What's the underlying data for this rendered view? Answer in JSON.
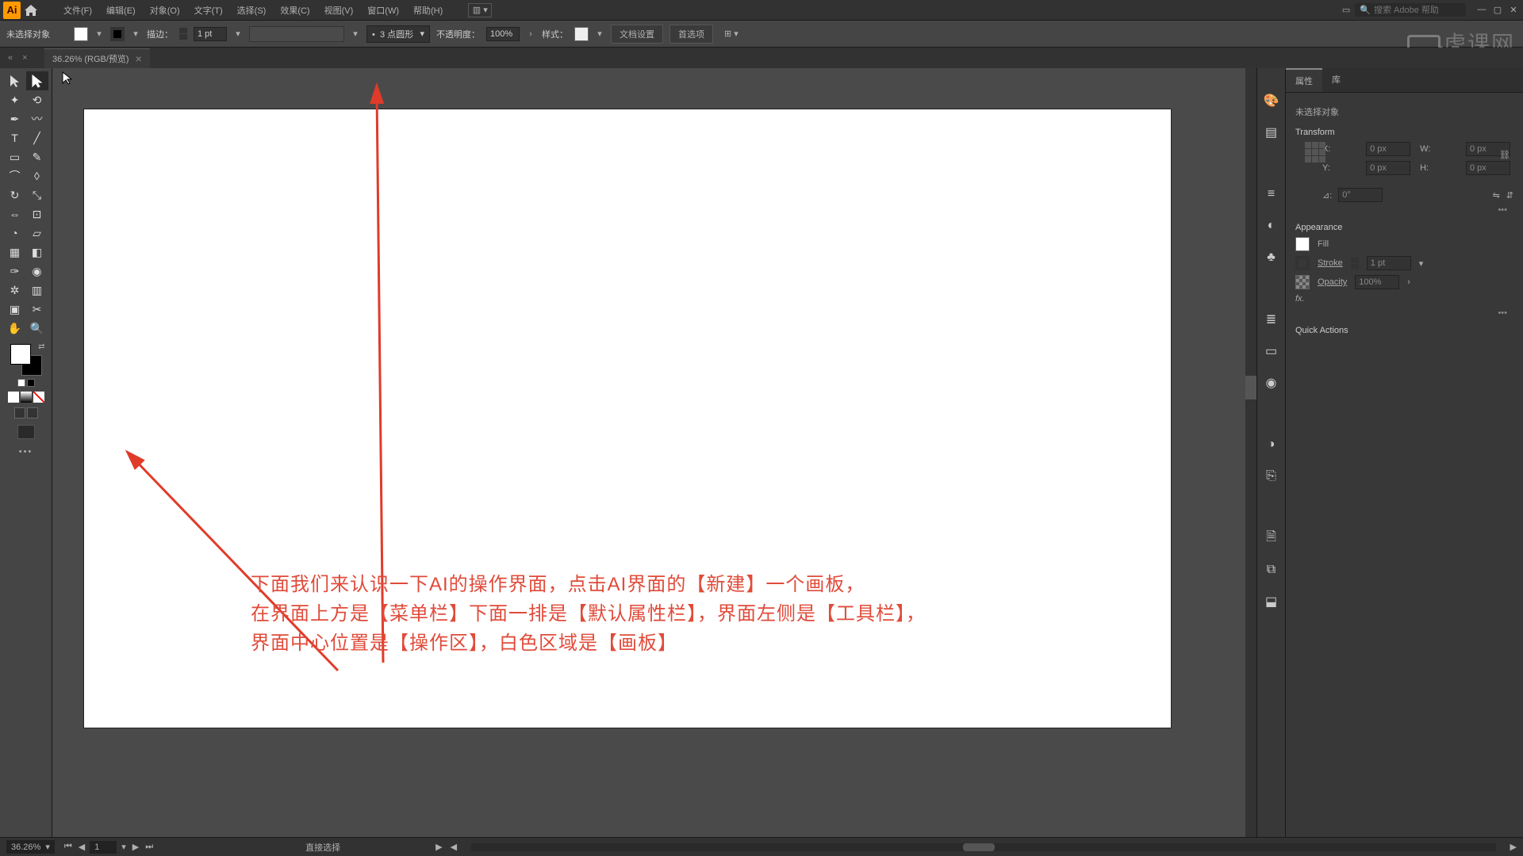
{
  "menu": {
    "items": [
      "文件(F)",
      "编辑(E)",
      "对象(O)",
      "文字(T)",
      "选择(S)",
      "效果(C)",
      "视图(V)",
      "窗口(W)",
      "帮助(H)"
    ],
    "search_placeholder": "搜索 Adobe 帮助"
  },
  "watermark": "虎课网",
  "control": {
    "no_sel": "未选择对象",
    "stroke_label": "描边：",
    "stroke_val": "1 pt",
    "dash_sel": "3 点圆形",
    "opacity_label": "不透明度：",
    "opacity_val": "100%",
    "style_label": "样式：",
    "docset": "文档设置",
    "prefs": "首选项"
  },
  "tab": {
    "title": "36.26% (RGB/预览)"
  },
  "status": {
    "zoom": "36.26%",
    "artboard": "1",
    "tool": "直接选择"
  },
  "panel": {
    "tabs": [
      "属性",
      "库"
    ],
    "no_sel": "未选择对象",
    "transform": "Transform",
    "x_label": "X:",
    "y_label": "Y:",
    "w_label": "W:",
    "h_label": "H:",
    "x": "0 px",
    "y": "0 px",
    "w": "0 px",
    "h": "0 px",
    "angle_label": "⊿:",
    "angle": "0°",
    "appearance": "Appearance",
    "fill": "Fill",
    "stroke": "Stroke",
    "stroke_val": "1 pt",
    "opacity": "Opacity",
    "opacity_val": "100%",
    "fx": "fx.",
    "quick": "Quick Actions"
  },
  "annotation": {
    "line1": "下面我们来认识一下AI的操作界面，点击AI界面的【新建】一个画板，",
    "line2": "在界面上方是【菜单栏】下面一排是【默认属性栏】，界面左侧是【工具栏】，",
    "line3": "界面中心位置是【操作区】，白色区域是【画板】"
  }
}
